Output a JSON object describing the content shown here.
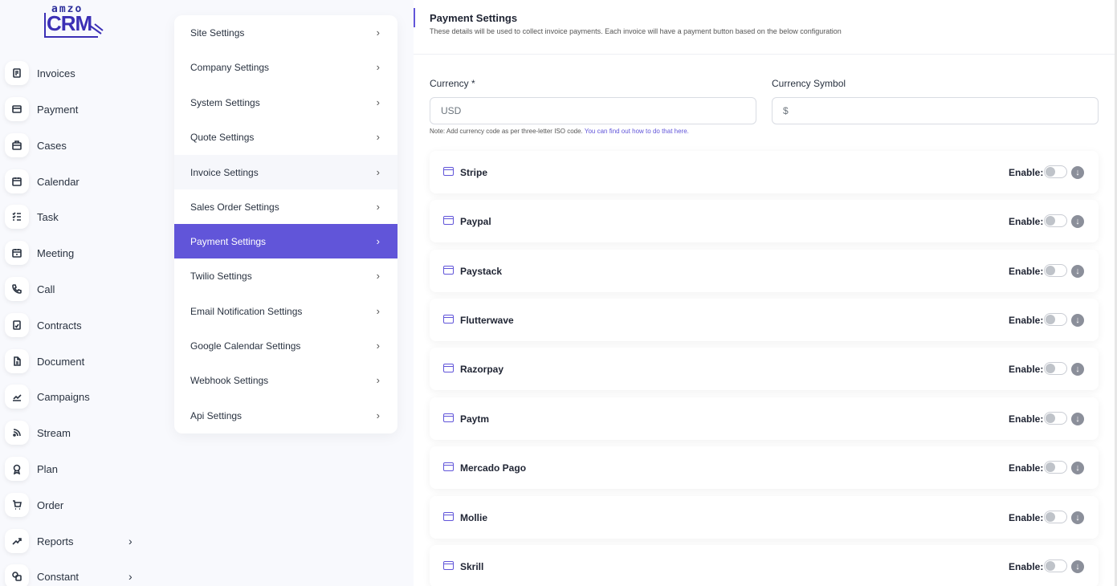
{
  "logo": {
    "top_text": "amzo",
    "brand_text": "CRM"
  },
  "sidebar": {
    "items": [
      {
        "label": "Invoices",
        "icon": "invoice-icon"
      },
      {
        "label": "Payment",
        "icon": "payment-icon"
      },
      {
        "label": "Cases",
        "icon": "briefcase-icon"
      },
      {
        "label": "Calendar",
        "icon": "calendar-icon"
      },
      {
        "label": "Task",
        "icon": "task-list-icon"
      },
      {
        "label": "Meeting",
        "icon": "meeting-calendar-icon"
      },
      {
        "label": "Call",
        "icon": "phone-icon"
      },
      {
        "label": "Contracts",
        "icon": "contract-icon"
      },
      {
        "label": "Document",
        "icon": "document-icon"
      },
      {
        "label": "Campaigns",
        "icon": "chart-line-icon"
      },
      {
        "label": "Stream",
        "icon": "rss-icon"
      },
      {
        "label": "Plan",
        "icon": "award-icon"
      },
      {
        "label": "Order",
        "icon": "cart-icon"
      },
      {
        "label": "Reports",
        "icon": "trending-icon",
        "chevron": "›"
      },
      {
        "label": "Constant",
        "icon": "shapes-icon",
        "chevron": "›"
      }
    ]
  },
  "settings_menu": {
    "items": [
      {
        "label": "Site Settings"
      },
      {
        "label": "Company Settings"
      },
      {
        "label": "System Settings"
      },
      {
        "label": "Quote Settings"
      },
      {
        "label": "Invoice Settings"
      },
      {
        "label": "Sales Order Settings"
      },
      {
        "label": "Payment Settings"
      },
      {
        "label": "Twilio Settings"
      },
      {
        "label": "Email Notification Settings"
      },
      {
        "label": "Google Calendar Settings"
      },
      {
        "label": "Webhook Settings"
      },
      {
        "label": "Api Settings"
      }
    ],
    "active": "Payment Settings",
    "hovered": "Invoice Settings",
    "chevron": "›"
  },
  "page": {
    "title": "Payment Settings",
    "subtitle": "These details will be used to collect invoice payments. Each invoice will have a payment button based on the below configuration"
  },
  "form": {
    "currency_label": "Currency *",
    "currency_value": "USD",
    "symbol_label": "Currency Symbol",
    "symbol_value": "$",
    "note_text": "Note: Add currency code as per three-letter ISO code.",
    "note_link": "You can find out how to do that here."
  },
  "gateways": {
    "enable_label": "Enable:",
    "expand_glyph": "↓",
    "items": [
      {
        "name": "Stripe",
        "enabled": false
      },
      {
        "name": "Paypal",
        "enabled": false
      },
      {
        "name": "Paystack",
        "enabled": false
      },
      {
        "name": "Flutterwave",
        "enabled": false
      },
      {
        "name": "Razorpay",
        "enabled": false
      },
      {
        "name": "Paytm",
        "enabled": false
      },
      {
        "name": "Mercado Pago",
        "enabled": false
      },
      {
        "name": "Mollie",
        "enabled": false
      },
      {
        "name": "Skrill",
        "enabled": false
      }
    ]
  },
  "colors": {
    "accent": "#6155d9",
    "text": "#293240",
    "background": "#f8f9fd"
  }
}
